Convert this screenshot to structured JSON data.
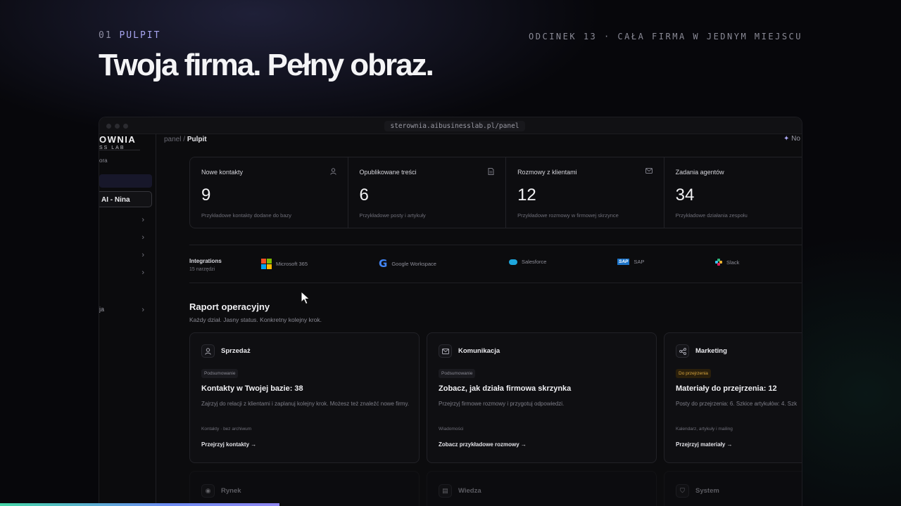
{
  "header": {
    "eyebrow_num": "01",
    "eyebrow_label": "PULPIT",
    "episode": "ODCINEK 13 · CAŁA FIRMA W JEDNYM MIEJSCU",
    "headline": "Twoja firma. Pełny obraz."
  },
  "browser": {
    "url": "sterownia.aibusinesslab.pl/panel"
  },
  "sidebar": {
    "logo_main": "OWNIA",
    "logo_sub": "SS LAB",
    "meta": "ora",
    "agent_chip": "AI - Nina",
    "frag_label": "ja"
  },
  "topbar": {
    "crumb_parent": "panel",
    "crumb_sep": "/",
    "crumb_current": "Pulpit",
    "new_label": "No"
  },
  "stats": [
    {
      "label": "Nowe kontakty",
      "icon": "user-icon",
      "value": "9",
      "desc": "Przykładowe kontakty dodane do bazy"
    },
    {
      "label": "Opublikowane treści",
      "icon": "document-icon",
      "value": "6",
      "desc": "Przykładowe posty i artykuły"
    },
    {
      "label": "Rozmowy z klientami",
      "icon": "mail-icon",
      "value": "12",
      "desc": "Przykładowe rozmowy w firmowej skrzynce"
    },
    {
      "label": "Zadania agentów",
      "icon": "bot-icon",
      "value": "34",
      "desc": "Przykładowe działania zespołu"
    }
  ],
  "integrations": {
    "title": "Integrations",
    "count": "15 narzędzi",
    "items": [
      {
        "name": "Microsoft 365",
        "icon": "microsoft-logo-icon"
      },
      {
        "name": "Google Workspace",
        "icon": "google-logo-icon"
      },
      {
        "name": "Salesforce",
        "icon": "salesforce-logo-icon"
      },
      {
        "name": "SAP",
        "icon": "sap-logo-icon"
      },
      {
        "name": "Slack",
        "icon": "slack-logo-icon"
      }
    ]
  },
  "report": {
    "title": "Raport operacyjny",
    "subtitle": "Każdy dział. Jasny status. Konkretny kolejny krok.",
    "cards": [
      {
        "name": "Sprzedaż",
        "icon": "user-icon",
        "badge": "Podsumowanie",
        "title": "Kontakty w Twojej bazie: 38",
        "desc": "Zajrzyj do relacji z klientami i zaplanuj kolejny krok. Możesz też znaleźć nowe firmy.",
        "meta": "Kontakty · bez archiwum",
        "link": "Przejrzyj kontakty →"
      },
      {
        "name": "Komunikacja",
        "icon": "mail-icon",
        "badge": "Podsumowanie",
        "title": "Zobacz, jak działa firmowa skrzynka",
        "desc": "Przejrzyj firmowe rozmowy i przygotuj odpowiedzi.",
        "meta": "Wiadomości",
        "link": "Zobacz przykładowe rozmowy →"
      },
      {
        "name": "Marketing",
        "icon": "share-icon",
        "badge": "Do przejrzenia",
        "title": "Materiały do przejrzenia: 12",
        "desc": "Posty do przejrzenia: 6. Szkice artykułów: 4. Szk",
        "meta": "Kalendarz, artykuły i mailing",
        "link": "Przejrzyj materiały →"
      }
    ],
    "next_cards": [
      {
        "name": "Rynek",
        "icon": "eye-icon"
      },
      {
        "name": "Wiedza",
        "icon": "document-icon"
      },
      {
        "name": "System",
        "icon": "shield-icon"
      }
    ]
  },
  "colors": {
    "accent": "#a8a5f0",
    "warning": "#d8a63f",
    "background": "#07070b"
  },
  "progress": {
    "value": 0.31
  }
}
